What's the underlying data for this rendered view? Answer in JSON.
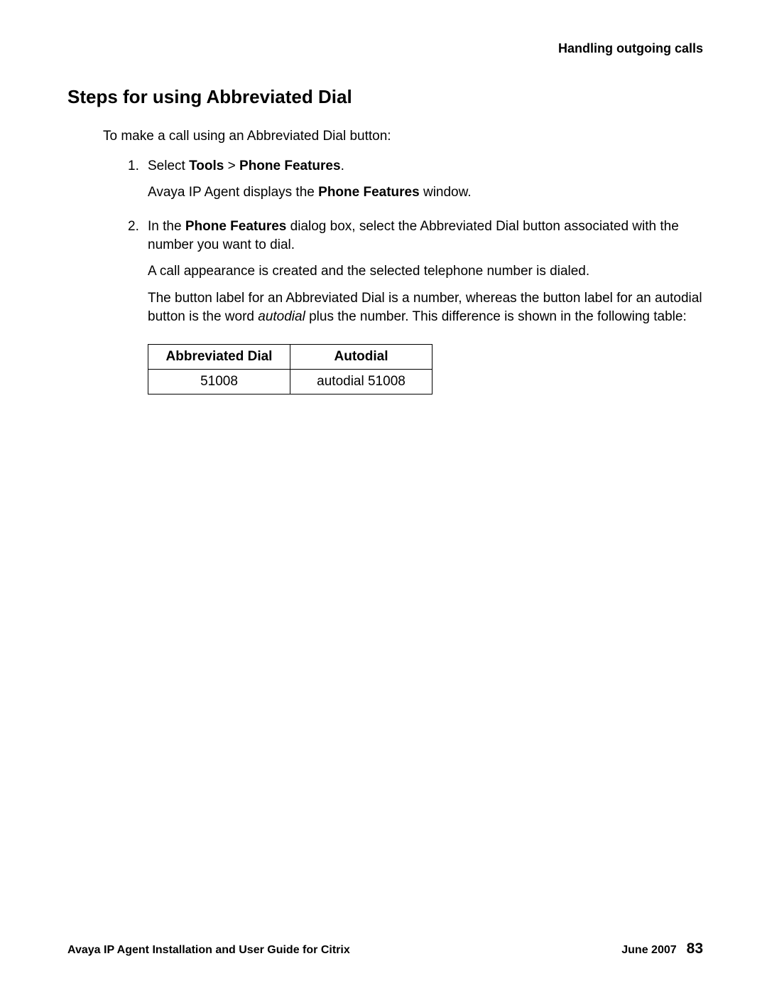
{
  "header": {
    "right": "Handling outgoing calls"
  },
  "title": "Steps for using Abbreviated Dial",
  "intro": "To make a call using an Abbreviated Dial button:",
  "steps": {
    "s1": {
      "num": "1.",
      "pre": "Select ",
      "bold1": "Tools",
      "gt": " > ",
      "bold2": "Phone Features",
      "post": ".",
      "line2_pre": "Avaya IP Agent displays the ",
      "line2_bold": "Phone Features",
      "line2_post": " window."
    },
    "s2": {
      "num": "2.",
      "pre": "In the ",
      "bold1": "Phone Features",
      "post": " dialog box, select the Abbreviated Dial button associated with the number you want to dial.",
      "line2": "A call appearance is created and the selected telephone number is dialed.",
      "line3_pre": "The button label for an Abbreviated Dial is a number, whereas the button label for an autodial button is the word ",
      "line3_italic": "autodial",
      "line3_post": " plus the number. This difference is shown in the following table:"
    }
  },
  "table": {
    "h1": "Abbreviated Dial",
    "h2": "Autodial",
    "c1": "51008",
    "c2": "autodial 51008"
  },
  "footer": {
    "left": "Avaya IP Agent Installation and User Guide for Citrix",
    "date": "June 2007",
    "page": "83"
  }
}
